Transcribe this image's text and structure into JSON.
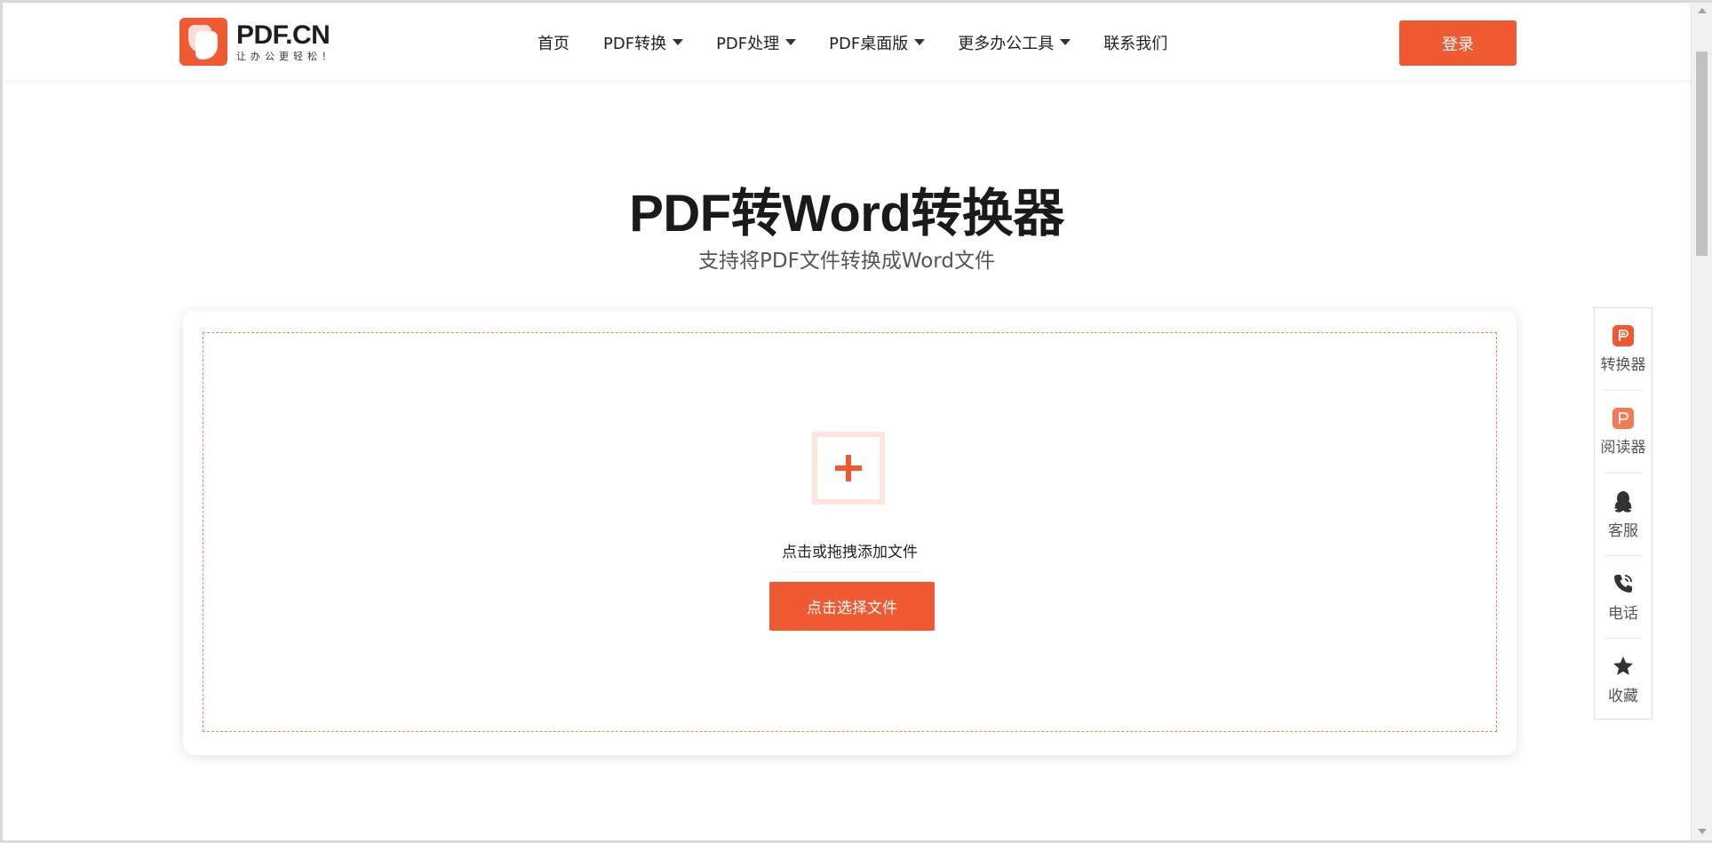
{
  "header": {
    "logo_title": "PDF.CN",
    "logo_slogan": "让办公更轻松！",
    "nav": [
      {
        "label": "首页",
        "has_dropdown": false
      },
      {
        "label": "PDF转换",
        "has_dropdown": true
      },
      {
        "label": "PDF处理",
        "has_dropdown": true
      },
      {
        "label": "PDF桌面版",
        "has_dropdown": true
      },
      {
        "label": "更多办公工具",
        "has_dropdown": true
      },
      {
        "label": "联系我们",
        "has_dropdown": false
      }
    ],
    "login_label": "登录"
  },
  "hero": {
    "title": "PDF转Word转换器",
    "subtitle": "支持将PDF文件转换成Word文件"
  },
  "upload": {
    "icon": "plus-icon",
    "hint": "点击或拖拽添加文件",
    "button_label": "点击选择文件"
  },
  "float_panel": {
    "items": [
      {
        "label": "转换器",
        "icon": "converter-p-icon"
      },
      {
        "label": "阅读器",
        "icon": "reader-p-icon"
      },
      {
        "label": "客服",
        "icon": "qq-penguin-icon"
      },
      {
        "label": "电话",
        "icon": "phone-icon"
      },
      {
        "label": "收藏",
        "icon": "star-icon"
      }
    ]
  },
  "colors": {
    "accent": "#f05a32",
    "accent_light": "#fde5dd",
    "text_dark": "#1a1a1a",
    "text_muted": "#555555"
  }
}
